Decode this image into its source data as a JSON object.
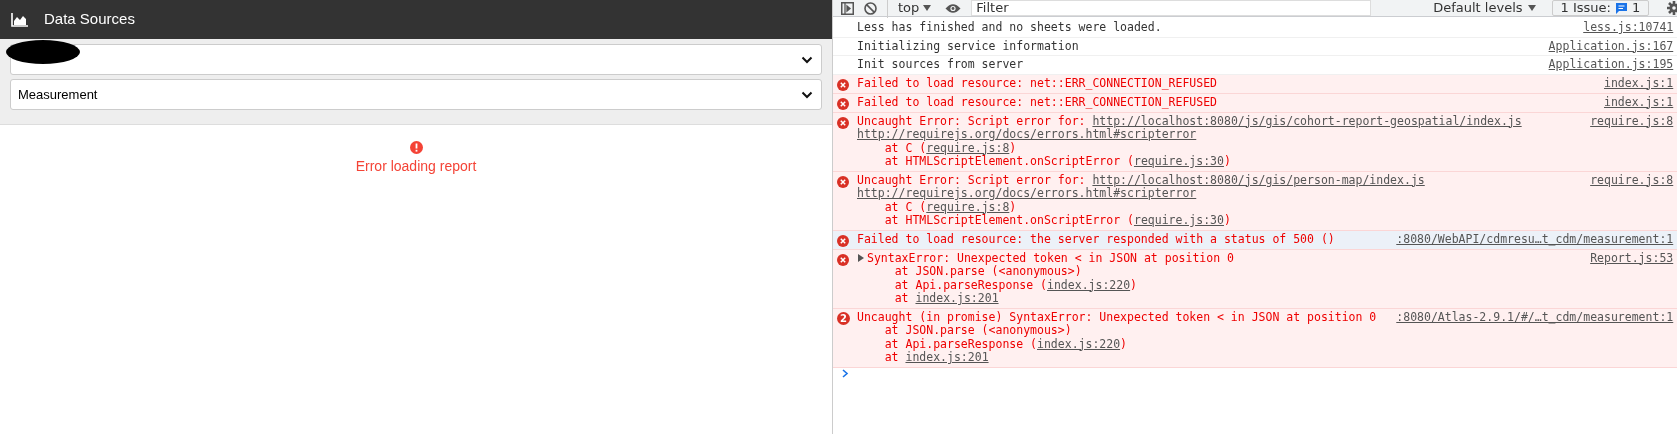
{
  "app": {
    "title": "Data Sources",
    "selects": [
      {
        "redacted": true
      },
      {
        "redacted": false,
        "value": "Measurement"
      }
    ],
    "error": "Error loading report"
  },
  "devtools": {
    "toolbar": {
      "context": "top",
      "filter_placeholder": "Filter",
      "levels": "Default levels",
      "issues_label": "1 Issue:",
      "issues_count": "1"
    },
    "messages": [
      {
        "kind": "log",
        "selected": false,
        "source": "less.js:10741",
        "lines": [
          [
            {
              "t": "Less has finished and no sheets were loaded.",
              "link": false
            }
          ]
        ]
      },
      {
        "kind": "log",
        "selected": false,
        "source": "Application.js:167",
        "lines": [
          [
            {
              "t": "Initializing service information",
              "link": false
            }
          ]
        ]
      },
      {
        "kind": "log",
        "selected": false,
        "source": "Application.js:195",
        "lines": [
          [
            {
              "t": "Init sources from server",
              "link": false
            }
          ]
        ]
      },
      {
        "kind": "error",
        "selected": false,
        "source": "index.js:1",
        "lines": [
          [
            {
              "t": "Failed to load resource: net::ERR_CONNECTION_REFUSED",
              "link": false
            }
          ]
        ]
      },
      {
        "kind": "error",
        "selected": false,
        "source": "index.js:1",
        "lines": [
          [
            {
              "t": "Failed to load resource: net::ERR_CONNECTION_REFUSED",
              "link": false
            }
          ]
        ]
      },
      {
        "kind": "error",
        "selected": false,
        "source": "require.js:8",
        "lines": [
          [
            {
              "t": "Uncaught Error: Script error for: ",
              "link": false
            },
            {
              "t": "http://localhost:8080/js/gis/cohort-report-geospatial/index.js",
              "link": true
            }
          ],
          [
            {
              "t": "http://requirejs.org/docs/errors.html#scripterror",
              "link": true
            }
          ],
          [
            {
              "t": "    at C (",
              "link": false
            },
            {
              "t": "require.js:8",
              "link": true
            },
            {
              "t": ")",
              "link": false
            }
          ],
          [
            {
              "t": "    at HTMLScriptElement.onScriptError (",
              "link": false
            },
            {
              "t": "require.js:30",
              "link": true
            },
            {
              "t": ")",
              "link": false
            }
          ]
        ]
      },
      {
        "kind": "error",
        "selected": false,
        "source": "require.js:8",
        "lines": [
          [
            {
              "t": "Uncaught Error: Script error for: ",
              "link": false
            },
            {
              "t": "http://localhost:8080/js/gis/person-map/index.js",
              "link": true
            }
          ],
          [
            {
              "t": "http://requirejs.org/docs/errors.html#scripterror",
              "link": true
            }
          ],
          [
            {
              "t": "    at C (",
              "link": false
            },
            {
              "t": "require.js:8",
              "link": true
            },
            {
              "t": ")",
              "link": false
            }
          ],
          [
            {
              "t": "    at HTMLScriptElement.onScriptError (",
              "link": false
            },
            {
              "t": "require.js:30",
              "link": true
            },
            {
              "t": ")",
              "link": false
            }
          ]
        ]
      },
      {
        "kind": "error",
        "selected": true,
        "source": ":8080/WebAPI/cdmresu…t_cdm/measurement:1",
        "lines": [
          [
            {
              "t": "Failed to load resource: the server responded with a status of 500 ()",
              "link": false
            }
          ]
        ]
      },
      {
        "kind": "error",
        "selected": false,
        "expandable": true,
        "source": "Report.js:53",
        "lines": [
          [
            {
              "t": "SyntaxError: Unexpected token < in JSON at position 0",
              "link": false
            }
          ],
          [
            {
              "t": "    at JSON.parse (<anonymous>)",
              "link": false
            }
          ],
          [
            {
              "t": "    at Api.parseResponse (",
              "link": false
            },
            {
              "t": "index.js:220",
              "link": true
            },
            {
              "t": ")",
              "link": false
            }
          ],
          [
            {
              "t": "    at ",
              "link": false
            },
            {
              "t": "index.js:201",
              "link": true
            }
          ]
        ]
      },
      {
        "kind": "error",
        "selected": false,
        "count": "2",
        "source": ":8080/Atlas-2.9.1/#/…t_cdm/measurement:1",
        "lines": [
          [
            {
              "t": "Uncaught (in promise) SyntaxError: Unexpected token < in JSON at position 0",
              "link": false
            }
          ],
          [
            {
              "t": "    at JSON.parse (<anonymous>)",
              "link": false
            }
          ],
          [
            {
              "t": "    at Api.parseResponse (",
              "link": false
            },
            {
              "t": "index.js:220",
              "link": true
            },
            {
              "t": ")",
              "link": false
            }
          ],
          [
            {
              "t": "    at ",
              "link": false
            },
            {
              "t": "index.js:201",
              "link": true
            }
          ]
        ]
      }
    ]
  }
}
